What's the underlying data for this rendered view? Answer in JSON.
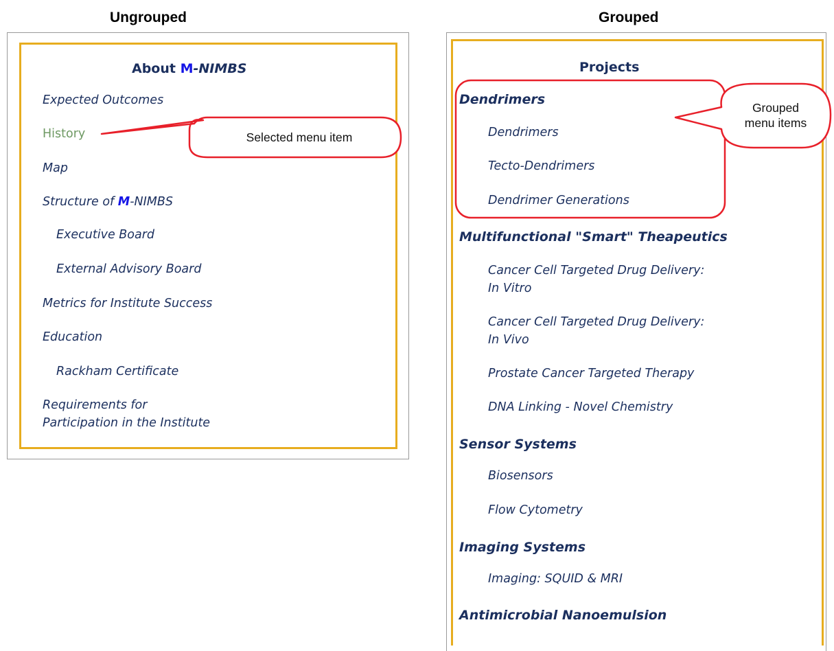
{
  "headers": {
    "ungrouped": "Ungrouped",
    "grouped": "Grouped"
  },
  "left_menu": {
    "title_prefix": "About ",
    "title_m": "M",
    "title_suffix": "-NIMBS",
    "items": [
      {
        "label": "Expected Outcomes"
      },
      {
        "label": "History",
        "state": "selected"
      },
      {
        "label": "Map"
      },
      {
        "label_prefix": "Structure of ",
        "label_m": "M",
        "label_suffix": "-NIMBS"
      },
      {
        "label": "Executive Board"
      },
      {
        "label": "External Advisory Board"
      },
      {
        "label": "Metrics for Institute Success"
      },
      {
        "label": "Education"
      },
      {
        "label": "Rackham Certificate"
      },
      {
        "label_line1": "Requirements for",
        "label_line2": "Participation in the Institute"
      }
    ],
    "callout": "Selected menu item"
  },
  "right_menu": {
    "title": "Projects",
    "groups": [
      {
        "heading": "Dendrimers",
        "items": [
          "Dendrimers",
          "Tecto-Dendrimers",
          "Dendrimer Generations"
        ]
      },
      {
        "heading": "Multifunctional \"Smart\" Theapeutics",
        "items": [
          {
            "line1": "Cancer Cell Targeted Drug Delivery:",
            "line2": "In Vitro"
          },
          {
            "line1": "Cancer Cell Targeted Drug Delivery:",
            "line2": "In Vivo"
          },
          "Prostate Cancer Targeted Therapy",
          "DNA Linking - Novel Chemistry"
        ]
      },
      {
        "heading": "Sensor Systems",
        "items": [
          "Biosensors",
          "Flow Cytometry"
        ]
      },
      {
        "heading": "Imaging Systems",
        "items": [
          "Imaging: SQUID & MRI"
        ]
      },
      {
        "heading": "Antimicrobial Nanoemulsion",
        "items": []
      }
    ],
    "callout_line1": "Grouped",
    "callout_line2": "menu items"
  },
  "colors": {
    "frame_border": "#9a9a9a",
    "menu_border": "#e7ad1f",
    "link_text": "#1b2f5e",
    "selected_text": "#6f9a64",
    "brand_m": "#1515e6",
    "callout_outline": "#e8202a"
  }
}
